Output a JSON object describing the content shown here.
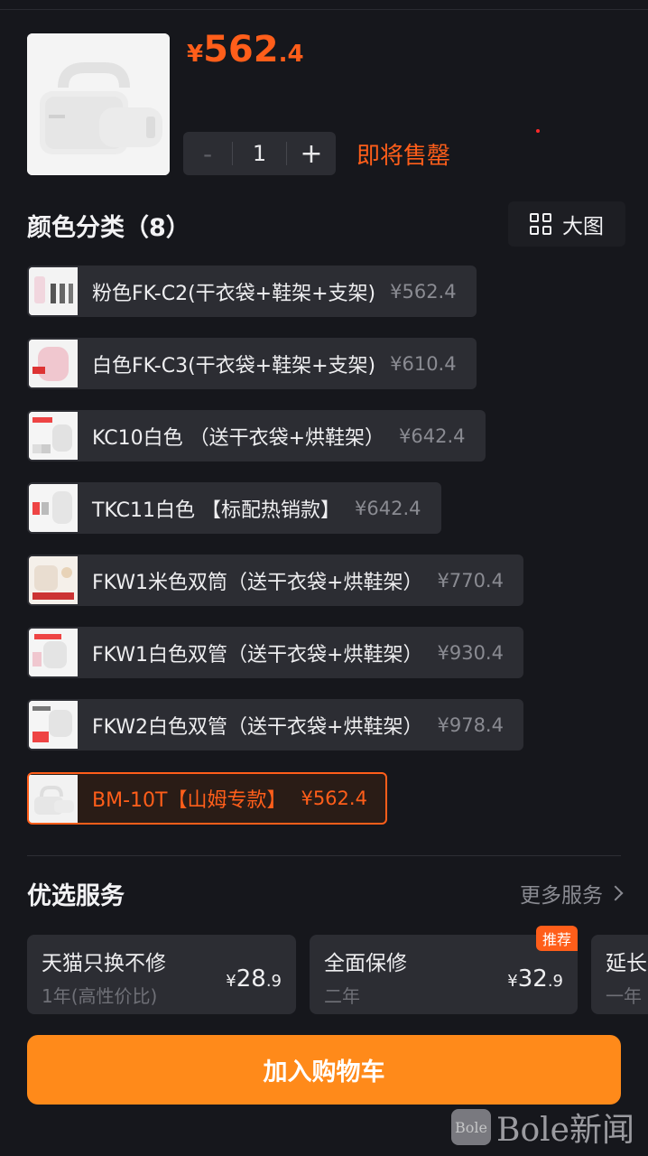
{
  "product": {
    "price": {
      "currency": "¥",
      "integer": "562",
      "decimal": ".4"
    },
    "stock_note": "即将售罄"
  },
  "quantity": {
    "minus": "-",
    "value": "1",
    "plus": "+"
  },
  "color_section": {
    "title": "颜色分类（8）",
    "view_toggle": "大图"
  },
  "variants": [
    {
      "label": "粉色FK-C2(干衣袋+鞋架+支架)",
      "price": "¥562.4",
      "selected": false
    },
    {
      "label": "白色FK-C3(干衣袋+鞋架+支架)",
      "price": "¥610.4",
      "selected": false
    },
    {
      "label": "KC10白色 （送干衣袋+烘鞋架）",
      "price": "¥642.4",
      "selected": false
    },
    {
      "label": "TKC11白色 【标配热销款】",
      "price": "¥642.4",
      "selected": false
    },
    {
      "label": "FKW1米色双筒（送干衣袋+烘鞋架）",
      "price": "¥770.4",
      "selected": false
    },
    {
      "label": "FKW1白色双管（送干衣袋+烘鞋架）",
      "price": "¥930.4",
      "selected": false
    },
    {
      "label": "FKW2白色双管（送干衣袋+烘鞋架）",
      "price": "¥978.4",
      "selected": false
    },
    {
      "label": "BM-10T【山姆专款】",
      "price": "¥562.4",
      "selected": true
    }
  ],
  "services": {
    "title": "优选服务",
    "more": "更多服务",
    "items": [
      {
        "name": "天猫只换不修",
        "term": "1年(高性价比)",
        "currency": "¥",
        "integer": "28",
        "decimal": ".9",
        "badge": ""
      },
      {
        "name": "全面保修",
        "term": "二年",
        "currency": "¥",
        "integer": "32",
        "decimal": ".9",
        "badge": "推荐"
      },
      {
        "name": "延长",
        "term": "一年",
        "currency": "",
        "integer": "",
        "decimal": "",
        "badge": ""
      }
    ]
  },
  "cart_button": "加入购物车",
  "watermark": {
    "logo": "Bole",
    "text": "Bole新闻"
  },
  "colors": {
    "accent": "#ff5e1a",
    "button": "#ff8a1a",
    "background": "#16171c",
    "card": "#2c2d33"
  }
}
